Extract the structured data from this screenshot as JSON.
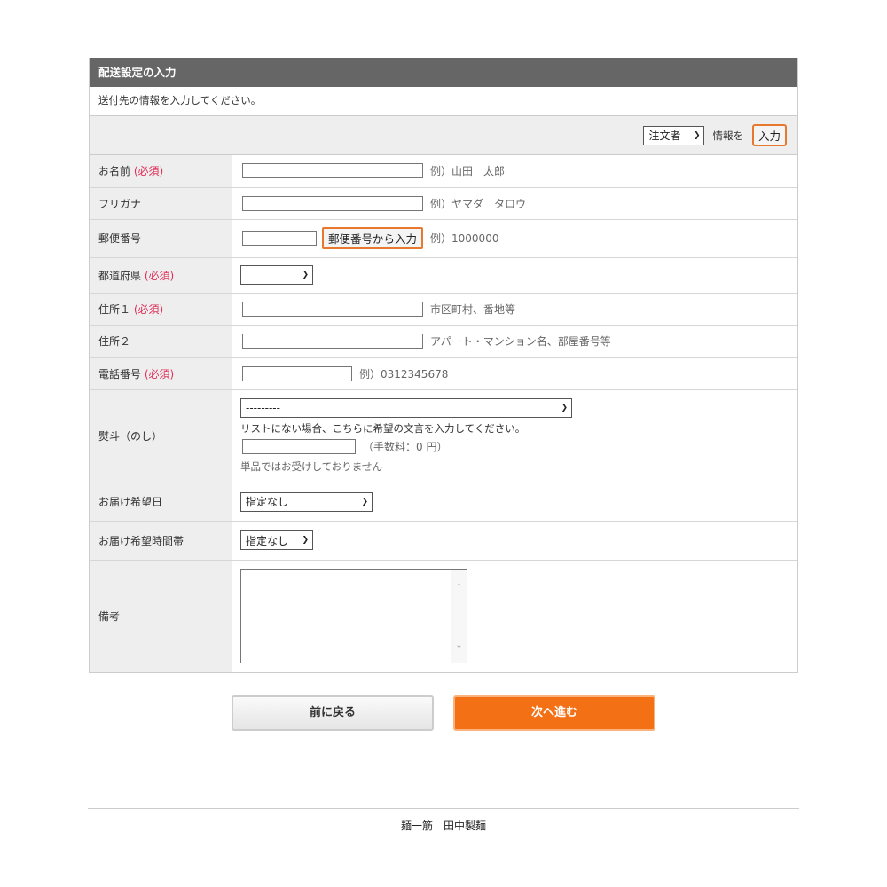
{
  "panel": {
    "title": "配送設定の入力",
    "intro": "送付先の情報を入力してください。"
  },
  "copy_bar": {
    "select_value": "注文者",
    "label": "情報を",
    "button": "入力"
  },
  "required_mark": "(必須)",
  "fields": {
    "name": {
      "label": "お名前",
      "hint": "例）山田　太郎"
    },
    "kana": {
      "label": "フリガナ",
      "hint": "例）ヤマダ　タロウ"
    },
    "zip": {
      "label": "郵便番号",
      "button": "郵便番号から入力",
      "hint": "例）1000000"
    },
    "pref": {
      "label": "都道府県",
      "value": ""
    },
    "addr1": {
      "label": "住所１",
      "hint": "市区町村、番地等"
    },
    "addr2": {
      "label": "住所２",
      "hint": "アパート・マンション名、部屋番号等"
    },
    "tel": {
      "label": "電話番号",
      "hint": "例）0312345678"
    },
    "noshi": {
      "label": "熨斗（のし）",
      "select_value": "---------",
      "note": "リストにない場合、こちらに希望の文言を入力してください。",
      "fee": "（手数料：0 円）",
      "small": "単品ではお受けしておりません"
    },
    "date": {
      "label": "お届け希望日",
      "value": "指定なし"
    },
    "time": {
      "label": "お届け希望時間帯",
      "value": "指定なし"
    },
    "remarks": {
      "label": "備考"
    }
  },
  "buttons": {
    "back": "前に戻る",
    "next": "次へ進む"
  },
  "footer": "麺一筋　田中製麺"
}
